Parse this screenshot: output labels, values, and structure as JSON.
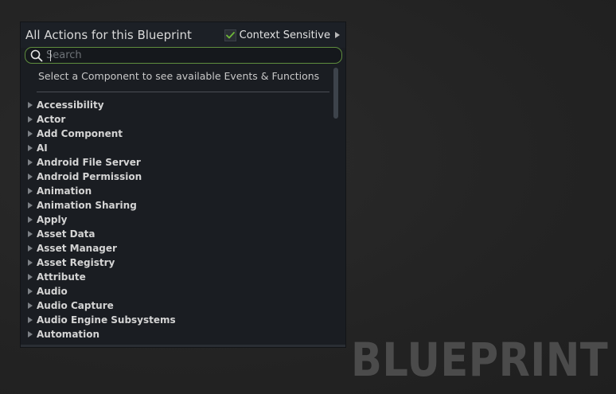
{
  "watermark": "BLUEPRINT",
  "action_menu": {
    "title": "All Actions for this Blueprint",
    "context_sensitive": {
      "label": "Context Sensitive",
      "checked": true
    },
    "search": {
      "placeholder": "Search",
      "value": ""
    },
    "hint": "Select a Component to see available Events & Functions",
    "categories": [
      "Accessibility",
      "Actor",
      "Add Component",
      "AI",
      "Android File Server",
      "Android Permission",
      "Animation",
      "Animation Sharing",
      "Apply",
      "Asset Data",
      "Asset Manager",
      "Asset Registry",
      "Attribute",
      "Audio",
      "Audio Capture",
      "Audio Engine Subsystems",
      "Automation"
    ]
  },
  "colors": {
    "search_focus_border": "#5f8d3e",
    "checkmark": "#6fb83a"
  }
}
